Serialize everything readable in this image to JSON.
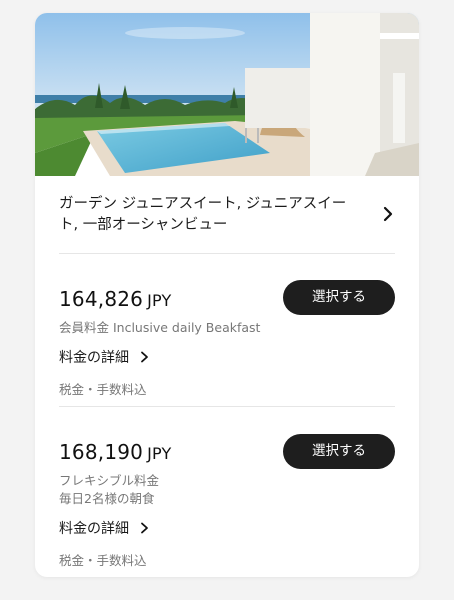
{
  "hero": {
    "alt_subject": "pool-terrace-photo"
  },
  "room": {
    "title": "ガーデン ジュニアスイート, ジュニアスイート, 一部オーシャンビュー"
  },
  "plans": [
    {
      "price": "164,826",
      "currency": "JPY",
      "select_label": "選択する",
      "desc_line1": "会員料金 Inclusive daily Beakfast",
      "desc_line2": "",
      "details_label": "料金の詳細",
      "tax_note": "税金・手数料込"
    },
    {
      "price": "168,190",
      "currency": "JPY",
      "select_label": "選択する",
      "desc_line1": "フレキシブル料金",
      "desc_line2": "毎日2名様の朝食",
      "details_label": "料金の詳細",
      "tax_note": "税金・手数料込"
    }
  ],
  "colors": {
    "button_bg": "#1e1e1e",
    "muted_text": "#777777",
    "pool": "#5fb8d6"
  }
}
